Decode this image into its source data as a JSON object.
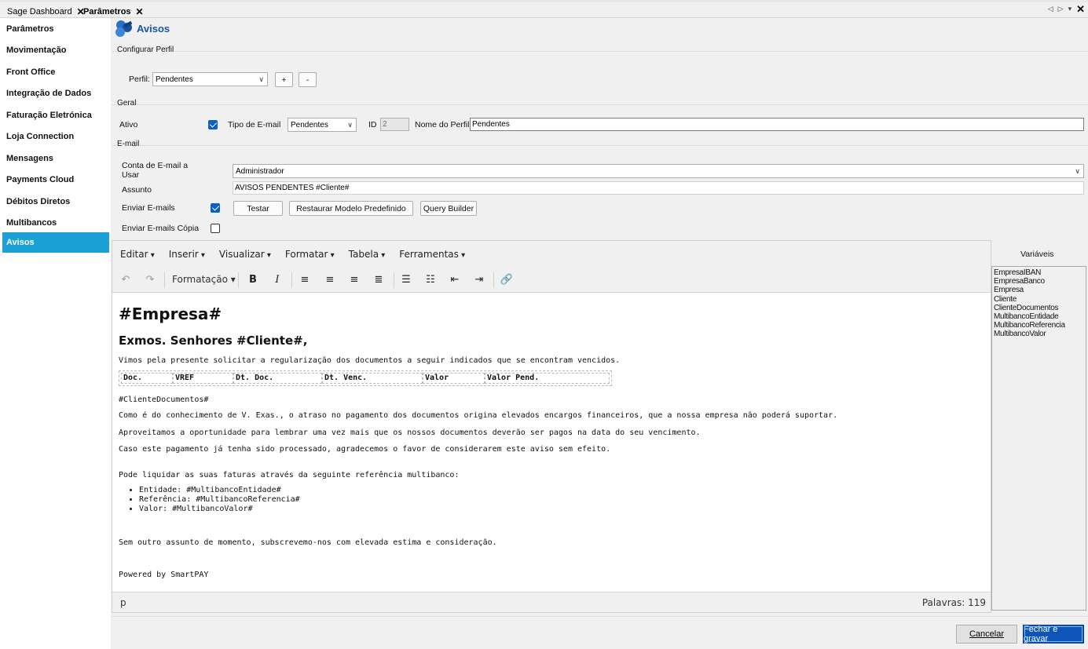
{
  "tabs": [
    {
      "label": "Sage Dashboard",
      "active": false
    },
    {
      "label": "Parâmetros",
      "active": true
    }
  ],
  "sidebar": {
    "items": [
      {
        "label": "Parâmetros"
      },
      {
        "label": "Movimentação"
      },
      {
        "label": "Front Office"
      },
      {
        "label": "Integração de Dados"
      },
      {
        "label": "Faturação Eletrónica"
      },
      {
        "label": "Loja Connection"
      },
      {
        "label": "Mensagens"
      },
      {
        "label": "Payments Cloud"
      },
      {
        "label": "Débitos Diretos"
      },
      {
        "label": "Multibancos"
      },
      {
        "label": "Avisos",
        "active": true
      }
    ]
  },
  "header": {
    "title": "Avisos"
  },
  "perfil_group": {
    "title": "Configurar Perfil",
    "perfil_label": "Perfil:",
    "perfil_value": "Pendentes",
    "add_label": "+",
    "remove_label": "-"
  },
  "geral": {
    "title": "Geral",
    "ativo_label": "Ativo",
    "ativo_checked": true,
    "tipo_label": "Tipo de E-mail",
    "tipo_value": "Pendentes",
    "id_label": "ID",
    "id_value": "2",
    "nome_label": "Nome do Perfil:",
    "nome_value": "Pendentes"
  },
  "email": {
    "title": "E-mail",
    "conta_label_1": "Conta de E-mail a",
    "conta_label_2": "Usar",
    "conta_value": "Administrador",
    "assunto_label": "Assunto",
    "assunto_value": "AVISOS PENDENTES #Cliente#",
    "enviar_label": "Enviar E-mails",
    "enviar_checked": true,
    "testar_label": "Testar",
    "restaurar_label": "Restaurar Modelo Predefinido",
    "query_label": "Query Builder",
    "copia_label": "Enviar E-mails Cópia",
    "copia_checked": false
  },
  "editor": {
    "menu": [
      "Editar",
      "Inserir",
      "Visualizar",
      "Formatar",
      "Tabela",
      "Ferramentas"
    ],
    "format_label": "Formatação",
    "heading1": "#Empresa#",
    "heading2": "Exmos. Senhores #Cliente#,",
    "intro": "Vimos pela presente solicitar a regularização dos documentos a seguir indicados que se encontram vencidos.",
    "table_headers": [
      "Doc.",
      "VREF",
      "Dt. Doc.",
      "Dt. Venc.",
      "Valor",
      "Valor Pend."
    ],
    "docs_placeholder": "#ClienteDocumentos#",
    "para1": "Como é do conhecimento de V. Exas., o atraso no pagamento dos documentos origina elevados encargos financeiros, que a nossa empresa não poderá suportar.",
    "para2": "Aproveitamos a oportunidade para lembrar uma vez mais que os nossos documentos deverão ser pagos na data do seu vencimento.",
    "para3": "Caso este pagamento já tenha sido processado, agradecemos o favor de considerarem este aviso sem efeito.",
    "para4": "Pode liquidar as suas faturas através da seguinte referência multibanco:",
    "list": [
      "Entidade: #MultibancoEntidade#",
      "Referência: #MultibancoReferencia#",
      "Valor: #MultibancoValor#"
    ],
    "closing": "Sem outro assunto de momento, subscrevemo-nos com elevada estima e consideração.",
    "powered": "Powered by SmartPAY",
    "status_path": "p",
    "word_count": "Palavras: 119"
  },
  "variables": {
    "title": "Variáveis",
    "items": [
      "EmpresaIBAN",
      "EmpresaBanco",
      "Empresa",
      "Cliente",
      "ClienteDocumentos",
      "MultibancoEntidade",
      "MultibancoReferencia",
      "MultibancoValor"
    ]
  },
  "footer": {
    "cancel_label": "Cancelar",
    "save_label": "Fechar e gravar"
  },
  "colors": {
    "accent": "#1ba1d6",
    "title_blue": "#1a56a8",
    "primary_button": "#0d55b8",
    "check_blue": "#0d5fc4"
  }
}
